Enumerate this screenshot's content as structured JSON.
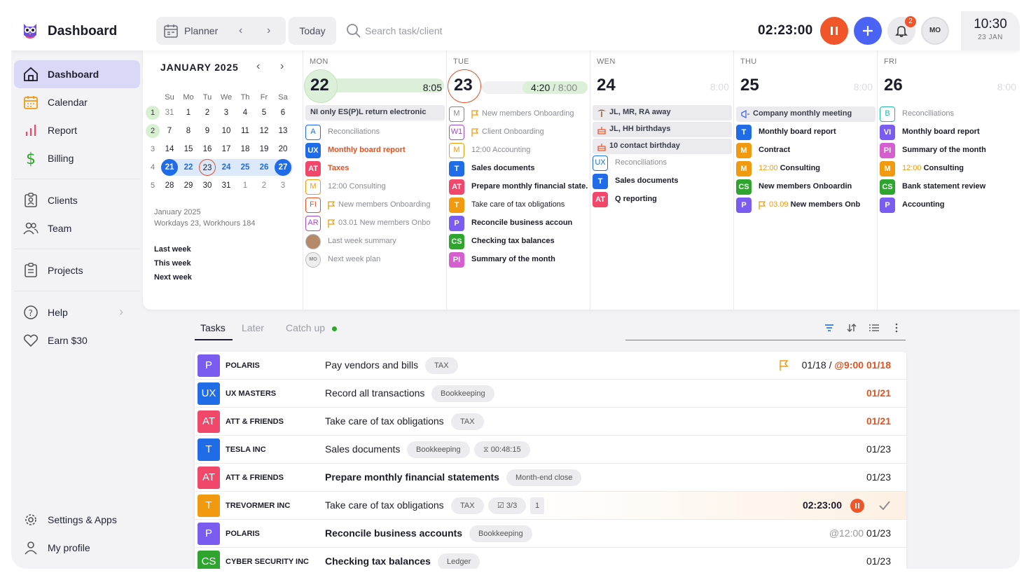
{
  "app": {
    "title": "Dashboard"
  },
  "topbar": {
    "view_label": "Planner",
    "today_label": "Today",
    "search_placeholder": "Search task/client",
    "timer": "02:23:00",
    "notifications": "2",
    "user_initials": "MO",
    "time": "10:30",
    "date": "23 JAN"
  },
  "colors": {
    "accent": "#4a63f5",
    "running": "#f0562a",
    "active_nav": "#d9d8f7"
  },
  "sidebar": {
    "items": [
      {
        "label": "Dashboard",
        "icon": "home-icon"
      },
      {
        "label": "Calendar",
        "icon": "calendar-icon"
      },
      {
        "label": "Report",
        "icon": "bar-chart-icon"
      },
      {
        "label": "Billing",
        "icon": "dollar-icon"
      },
      {
        "label": "Clients",
        "icon": "clipboard-user-icon"
      },
      {
        "label": "Team",
        "icon": "users-icon"
      },
      {
        "label": "Projects",
        "icon": "list-clipboard-icon"
      },
      {
        "label": "Help",
        "icon": "help-icon"
      },
      {
        "label": "Earn $30",
        "icon": "heart-icon"
      },
      {
        "label": "Settings & Apps",
        "icon": "gear-icon"
      },
      {
        "label": "My profile",
        "icon": "user-icon"
      }
    ]
  },
  "mini_calendar": {
    "title": "JANUARY 2025",
    "weekdays": [
      "Su",
      "Mo",
      "Tu",
      "We",
      "Th",
      "Fr",
      "Sa"
    ],
    "weeks": [
      {
        "num": "1",
        "days": [
          "31",
          "1",
          "2",
          "3",
          "4",
          "5",
          "6"
        ]
      },
      {
        "num": "2",
        "days": [
          "7",
          "8",
          "9",
          "10",
          "11",
          "12",
          "13"
        ]
      },
      {
        "num": "3",
        "days": [
          "14",
          "15",
          "16",
          "17",
          "18",
          "19",
          "20"
        ]
      },
      {
        "num": "4",
        "days": [
          "21",
          "22",
          "23",
          "24",
          "25",
          "26",
          "27"
        ]
      },
      {
        "num": "5",
        "days": [
          "28",
          "29",
          "30",
          "31",
          "1",
          "2",
          "3"
        ]
      }
    ],
    "meta_month": "January 2025",
    "meta_work": "Workdays 23, Workhours 184",
    "quick_links": [
      "Last week",
      "This week",
      "Next week"
    ]
  },
  "days": [
    {
      "name": "MON",
      "num": "22",
      "hours": "8:05",
      "events": [
        {
          "text": "NI only ES(P)L return electronic",
          "badge": "",
          "shade": true
        },
        {
          "badge": "A",
          "text": "Reconciliations",
          "style": "muted",
          "bcolor": "#1f6be8",
          "outline": true
        },
        {
          "badge": "UX",
          "text": "Monthly board report",
          "style": "orange",
          "bcolor": "#1f6be8"
        },
        {
          "badge": "AT",
          "text": "Taxes",
          "style": "orange",
          "bcolor": "#f0476b"
        },
        {
          "badge": "M",
          "text": "12:00 Consulting",
          "style": "muted",
          "bcolor": "#f29a0f",
          "outline": true
        },
        {
          "badge": "FI",
          "text": "New members Onboarding",
          "style": "muted",
          "bcolor": "#e7501f",
          "outline": true,
          "flag": true
        },
        {
          "badge": "AR",
          "text": "03.01 New members Onbo",
          "style": "muted",
          "bcolor": "#a64bd6",
          "outline": true,
          "flag": true
        },
        {
          "badge": "",
          "text": "Last week summary",
          "style": "muted",
          "avatar": "photo"
        },
        {
          "badge": "MO",
          "text": "Next week plan",
          "style": "muted",
          "avatar": "mo"
        }
      ]
    },
    {
      "name": "TUE",
      "num": "23",
      "hours": "4:20",
      "hours_total": "/ 8:00",
      "events": [
        {
          "badge": "M",
          "text": "New members Onboarding",
          "style": "muted",
          "bcolor": "#888",
          "outline": true,
          "flag": true
        },
        {
          "badge": "W1",
          "text": "Client Onboarding",
          "style": "muted",
          "bcolor": "#a64bd6",
          "outline": true,
          "flag": true
        },
        {
          "badge": "M",
          "text": "12:00 Accounting",
          "style": "muted",
          "bcolor": "#f29a0f",
          "outline": true
        },
        {
          "badge": "T",
          "text": "Sales documents",
          "style": "bold",
          "bcolor": "#1f6be8"
        },
        {
          "badge": "AT",
          "text": "Prepare monthly financial state.",
          "style": "bold",
          "bcolor": "#f0476b"
        },
        {
          "badge": "T",
          "text": "Take care of tax obligations",
          "style": "normal",
          "bcolor": "#f29a0f"
        },
        {
          "badge": "P",
          "text": "Reconcile business accoun",
          "style": "bold",
          "bcolor": "#7a5cf0"
        },
        {
          "badge": "CS",
          "text": "Checking tax balances",
          "style": "bold",
          "bcolor": "#2fa52f"
        },
        {
          "badge": "PI",
          "text": "Summary of the month",
          "style": "bold",
          "bcolor": "#d65fcf"
        }
      ]
    },
    {
      "name": "WEN",
      "num": "24",
      "hours": "8:00",
      "events": [
        {
          "text": "JL, MR, RA away",
          "shade": true,
          "icon": "palm"
        },
        {
          "text": "JL, HH birthdays",
          "shade": true,
          "icon": "cake"
        },
        {
          "text": "10 contact birthday",
          "shade": true,
          "icon": "cake"
        },
        {
          "badge": "UX",
          "text": "Reconciliations",
          "style": "muted",
          "bcolor": "#1f6be8",
          "outline": true
        },
        {
          "badge": "T",
          "text": "Sales documents",
          "style": "bold",
          "bcolor": "#1f6be8"
        },
        {
          "badge": "AT",
          "text": "Q reporting",
          "style": "bold",
          "bcolor": "#f0476b"
        }
      ]
    },
    {
      "name": "THU",
      "num": "25",
      "hours": "8:00",
      "events": [
        {
          "text": "Company monthly meeting",
          "shade": true,
          "icon": "megaphone"
        },
        {
          "badge": "T",
          "text": "Monthly board report",
          "style": "bold",
          "bcolor": "#1f6be8"
        },
        {
          "badge": "M",
          "text": "Contract",
          "style": "bold",
          "bcolor": "#f29a0f"
        },
        {
          "badge": "M",
          "text": "12:00 Consulting",
          "style": "bold",
          "bcolor": "#f29a0f",
          "time": "12:00"
        },
        {
          "badge": "CS",
          "text": "New members Onboardin",
          "style": "bold",
          "bcolor": "#2fa52f"
        },
        {
          "badge": "P",
          "text": "03.09 New members Onb",
          "style": "bold",
          "bcolor": "#7a5cf0",
          "flag": true,
          "time": "03.09"
        }
      ]
    },
    {
      "name": "FRI",
      "num": "26",
      "hours": "8:00",
      "events": [
        {
          "badge": "B",
          "text": "Reconciliations",
          "style": "muted",
          "bcolor": "#22b8a8",
          "outline": true
        },
        {
          "badge": "VI",
          "text": "Monthly board report",
          "style": "bold",
          "bcolor": "#7a5cf0"
        },
        {
          "badge": "PI",
          "text": "Summary of the month",
          "style": "bold",
          "bcolor": "#d65fcf"
        },
        {
          "badge": "M",
          "text": "12:00 Consulting",
          "style": "bold",
          "bcolor": "#f29a0f",
          "time": "12:00"
        },
        {
          "badge": "CS",
          "text": "Bank statement review",
          "style": "bold",
          "bcolor": "#2fa52f"
        },
        {
          "badge": "P",
          "text": "Accounting",
          "style": "bold",
          "bcolor": "#7a5cf0"
        }
      ]
    }
  ],
  "tasks_panel": {
    "tabs": [
      "Tasks",
      "Later",
      "Catch up"
    ],
    "rows": [
      {
        "badge": "P",
        "bcolor": "#7a5cf0",
        "client": "POLARIS",
        "task": "Pay vendors and bills",
        "tags": [
          "TAX"
        ],
        "due": "01/18 /",
        "due_extra": "@9:00 01/18",
        "flag": true
      },
      {
        "badge": "UX",
        "bcolor": "#1f6be8",
        "client": "UX MASTERS",
        "task": "Record all transactions",
        "tags": [
          "Bookkeeping"
        ],
        "due": "01/21",
        "due_orange": true
      },
      {
        "badge": "AT",
        "bcolor": "#f0476b",
        "client": "ATT & FRIENDS",
        "task": "Take care of tax obligations",
        "tags": [
          "TAX"
        ],
        "due": "01/21",
        "due_orange": true
      },
      {
        "badge": "T",
        "bcolor": "#1f6be8",
        "client": "TESLA INC",
        "task": "Sales documents",
        "tags": [
          "Bookkeeping",
          "00:48:15"
        ],
        "due": "01/23"
      },
      {
        "badge": "AT",
        "bcolor": "#f0476b",
        "client": "ATT & FRIENDS",
        "task": "Prepare monthly financial statements",
        "bold": true,
        "tags": [
          "Month-end close"
        ],
        "due": "01/23"
      },
      {
        "badge": "T",
        "bcolor": "#f29a0f",
        "client": "TREVORMER INC",
        "task": "Take care of tax obligations",
        "tags": [
          "TAX",
          "3/3",
          "1"
        ],
        "running": "02:23:00"
      },
      {
        "badge": "P",
        "bcolor": "#7a5cf0",
        "client": "POLARIS",
        "task": "Reconcile business accounts",
        "bold": true,
        "tags": [
          "Bookkeeping"
        ],
        "due_pre": "@12:00",
        "due": "01/23"
      },
      {
        "badge": "CS",
        "bcolor": "#2fa52f",
        "client": "CYBER SECURITY INC",
        "task": "Checking tax balances",
        "bold": true,
        "tags": [
          "Ledger"
        ],
        "due": "01/23"
      }
    ]
  }
}
